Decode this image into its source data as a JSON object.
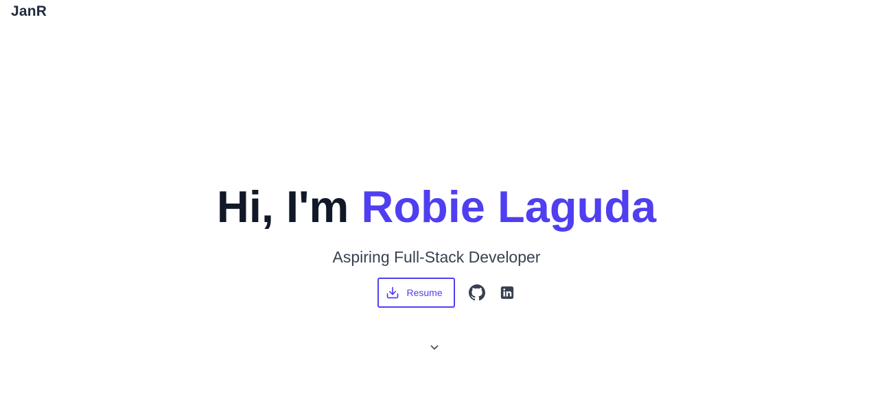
{
  "header": {
    "brand": "JanR"
  },
  "hero": {
    "greeting": "Hi, I'm ",
    "name": "Robie Laguda",
    "subtitle": "Aspiring Full-Stack Developer",
    "resume_label": "Resume"
  },
  "icons": {
    "download": "download-icon",
    "github": "github-icon",
    "linkedin": "linkedin-icon",
    "scroll": "chevron-down-icon"
  },
  "colors": {
    "accent": "#4f3ff0",
    "heading": "#111827",
    "text": "#374151",
    "icon": "#374151"
  }
}
